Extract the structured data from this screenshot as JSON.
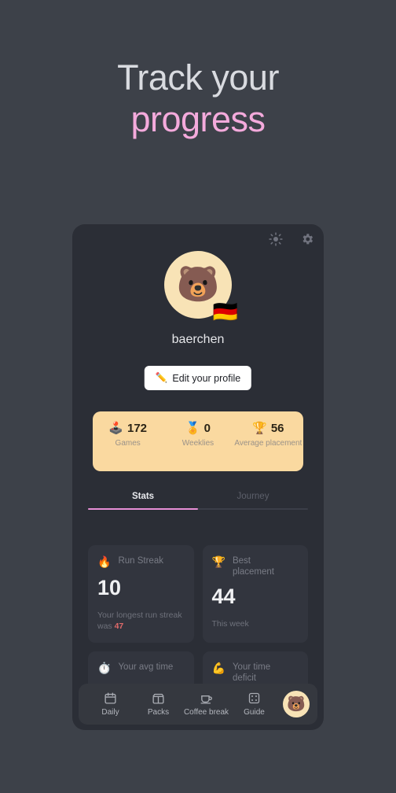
{
  "headline": {
    "line1": "Track your",
    "line2": "progress",
    "color_primary": "#d9dbe0",
    "color_accent": "#f4aadc"
  },
  "app": {
    "topbar": {
      "brightness_icon": "sun-icon",
      "settings_icon": "gear-icon"
    },
    "profile": {
      "avatar_emoji": "🐻",
      "flag_emoji": "🇩🇪",
      "username": "baerchen",
      "edit_button_label": "Edit your profile",
      "edit_button_icon": "✏️"
    },
    "summary_strip": {
      "background": "#fad9a0",
      "items": [
        {
          "icon": "🕹️",
          "value": "172",
          "label": "Games"
        },
        {
          "icon": "🏅",
          "value": "0",
          "label": "Weeklies"
        },
        {
          "icon": "🏆",
          "value": "56",
          "label": "Average placement"
        }
      ]
    },
    "tabs": {
      "items": [
        {
          "label": "Stats",
          "active": true
        },
        {
          "label": "Journey",
          "active": false
        }
      ],
      "indicator_color": "#e78fd6"
    },
    "cards": [
      {
        "icon": "🔥",
        "title": "Run Streak",
        "value": "10",
        "sub_prefix": "Your longest run streak was ",
        "sub_highlight": "47"
      },
      {
        "icon": "🏆",
        "title": "Best placement",
        "value": "44",
        "sub_prefix": "This week",
        "sub_highlight": ""
      },
      {
        "icon": "⏱️",
        "title": "Your avg time",
        "value": "",
        "sub_prefix": "",
        "sub_highlight": ""
      },
      {
        "icon": "💪",
        "title": "Your time deficit",
        "value": "",
        "sub_prefix": "",
        "sub_highlight": ""
      }
    ],
    "navbar": {
      "items": [
        {
          "icon": "calendar-icon",
          "label": "Daily"
        },
        {
          "icon": "packs-icon",
          "label": "Packs"
        },
        {
          "icon": "coffee-cup-icon",
          "label": "Coffee break"
        },
        {
          "icon": "dice-icon",
          "label": "Guide"
        }
      ],
      "avatar_emoji": "🐻"
    }
  }
}
